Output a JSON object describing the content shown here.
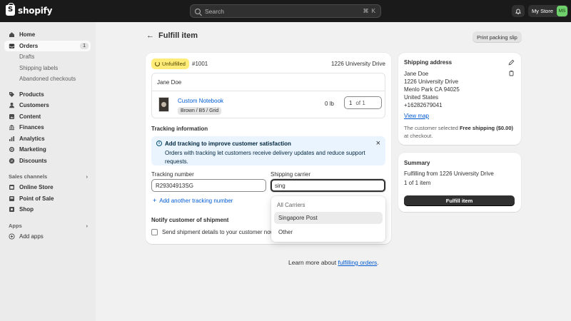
{
  "topbar": {
    "brand": "shopify",
    "search_placeholder": "Search",
    "search_shortcut": "⌘ K",
    "store_name": "My Store",
    "avatar_initials": "MS"
  },
  "sidebar": {
    "home": "Home",
    "orders": "Orders",
    "orders_count": "1",
    "drafts": "Drafts",
    "shipping_labels": "Shipping labels",
    "abandoned_checkouts": "Abandoned checkouts",
    "products": "Products",
    "customers": "Customers",
    "content": "Content",
    "finances": "Finances",
    "analytics": "Analytics",
    "marketing": "Marketing",
    "discounts": "Discounts",
    "sales_channels": "Sales channels",
    "online_store": "Online Store",
    "point_of_sale": "Point of Sale",
    "shop": "Shop",
    "apps": "Apps",
    "add_apps": "Add apps"
  },
  "page": {
    "title": "Fulfill item",
    "print_button": "Print packing slip"
  },
  "fulfillment": {
    "status_badge": "Unfulfilled",
    "order_number": "#1001",
    "location": "1226 University Drive",
    "customer_name": "Jane Doe",
    "product_name": "Custom Notebook",
    "product_variant": "Brown / B5 / Grid",
    "weight": "0 lb",
    "quantity": "1",
    "quantity_of": "of 1"
  },
  "tracking": {
    "section_title": "Tracking information",
    "banner_title": "Add tracking to improve customer satisfaction",
    "banner_body": "Orders with tracking let customers receive delivery updates and reduce support requests.",
    "tracking_number_label": "Tracking number",
    "tracking_number_value": "R29304913SG",
    "carrier_label": "Shipping carrier",
    "carrier_value": "sing",
    "add_another": "Add another tracking number",
    "dropdown_header": "All Carriers",
    "dropdown_options": [
      "Singapore Post",
      "Other"
    ]
  },
  "notify": {
    "title": "Notify customer of shipment",
    "checkbox_label": "Send shipment details to your customer now"
  },
  "shipping_address": {
    "title": "Shipping address",
    "lines": [
      "Jane Doe",
      "1226 University Drive",
      "Menlo Park CA 94025",
      "United States",
      "+16282679041"
    ],
    "view_map": "View map",
    "note_prefix": "The customer selected",
    "note_bold": "Free shipping ($0.00)",
    "note_suffix": "at checkout."
  },
  "summary": {
    "title": "Summary",
    "fulfilling_from": "Fulfilling from 1226 University Drive",
    "item_count": "1 of 1 item",
    "fulfill_button": "Fulfill item"
  },
  "footer": {
    "prefix": "Learn more about",
    "link": "fulfilling orders",
    "suffix": "."
  },
  "colors": {
    "topbar": "#1a1a1a",
    "badge": "#ffeb78",
    "banner": "#eaf4ff",
    "link": "#005bd3",
    "primary_button": "#303030",
    "avatar": "#6fd16b"
  }
}
